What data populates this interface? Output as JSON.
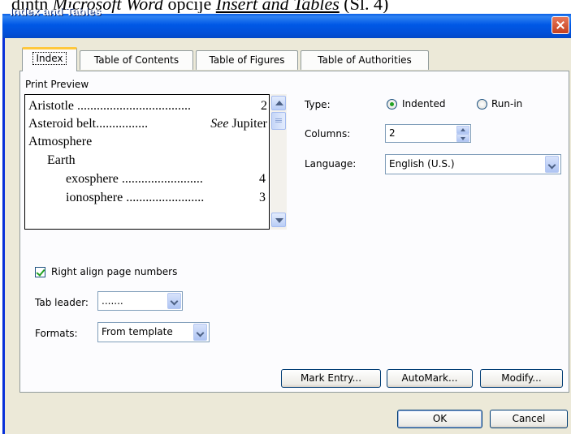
{
  "document": {
    "prefix": "dintn ",
    "app_name": "Microsoft Word",
    "middle": " opcije ",
    "menu_ref": "Insert and Tables",
    "suffix": " (Sl. 4)"
  },
  "window": {
    "title": "Index and Tables"
  },
  "tabs": [
    {
      "label": "Index",
      "active": true
    },
    {
      "label": "Table of Contents",
      "active": false
    },
    {
      "label": "Table of Figures",
      "active": false
    },
    {
      "label": "Table of Authorities",
      "active": false
    }
  ],
  "preview": {
    "label": "Print Preview",
    "lines": [
      {
        "entry": "Aristotle ...................................",
        "page": "2"
      },
      {
        "entry": "Asteroid belt................",
        "see": "See",
        "page": "Jupiter"
      },
      {
        "entry": "Atmosphere",
        "page": ""
      },
      {
        "entry": "Earth",
        "page": ""
      },
      {
        "entry": "exosphere .........................",
        "page": "4"
      },
      {
        "entry": "ionosphere ........................",
        "page": "3"
      }
    ]
  },
  "type": {
    "label": "Type:",
    "options": [
      {
        "label": "Indented",
        "checked": true
      },
      {
        "label": "Run-in",
        "checked": false
      }
    ]
  },
  "columns": {
    "label": "Columns:",
    "value": "2"
  },
  "language": {
    "label": "Language:",
    "value": "English (U.S.)"
  },
  "right_align": {
    "label": "Right align page numbers",
    "checked": true
  },
  "tab_leader": {
    "label": "Tab leader:",
    "value": "......."
  },
  "formats": {
    "label": "Formats:",
    "value": "From template"
  },
  "buttons": {
    "mark_entry": "Mark Entry...",
    "automark": "AutoMark...",
    "modify": "Modify...",
    "ok": "OK",
    "cancel": "Cancel"
  },
  "colors": {
    "titlebar": "#0058e6",
    "dialog_bg": "#ece9d8",
    "panel_bg": "#fcfcfe",
    "active_tab_accent": "#ffc83c",
    "check_green": "#21a121"
  }
}
